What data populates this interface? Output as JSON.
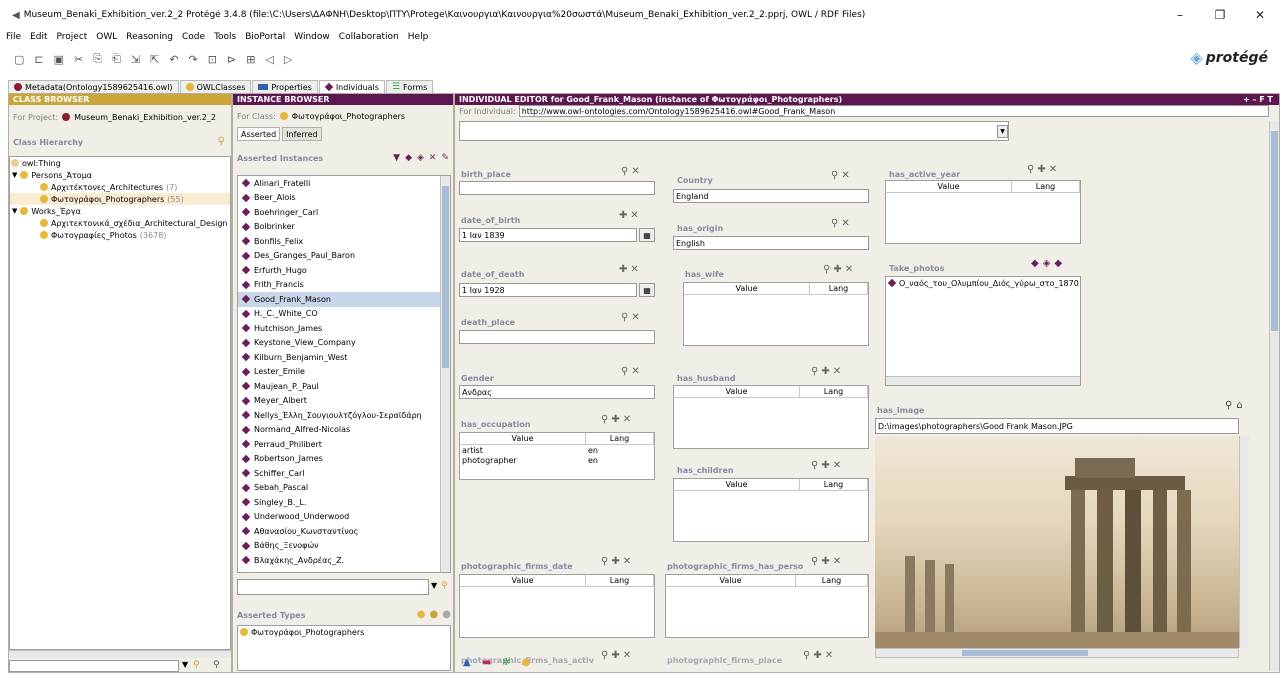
{
  "window": {
    "title": "Museum_Benaki_Exhibition_ver.2_2  Protégé 3.4.8   (file:\\C:\\Users\\ΔΑΦΝΗ\\Desktop\\ΠΤΥ\\Protege\\Καινουργια\\Καινουργια%20σωστά\\Museum_Benaki_Exhibition_ver.2_2.pprj, OWL / RDF Files)",
    "minimize": "–",
    "maximize": "❐",
    "close": "✕"
  },
  "menu": [
    "File",
    "Edit",
    "Project",
    "OWL",
    "Reasoning",
    "Code",
    "Tools",
    "BioPortal",
    "Window",
    "Collaboration",
    "Help"
  ],
  "logo": "protégé",
  "tabs": [
    {
      "label": "Metadata(Ontology1589625416.owl)",
      "color": "#8a1c30"
    },
    {
      "label": "OWLClasses",
      "color": "#e8b838"
    },
    {
      "label": "Properties",
      "color": "#3060b0"
    },
    {
      "label": "Individuals",
      "color": "#6b1f5a"
    },
    {
      "label": "Forms",
      "color": "#30a050"
    }
  ],
  "class_browser": {
    "header": "CLASS BROWSER",
    "project_label": "For Project:",
    "project_name": "Museum_Benaki_Exhibition_ver.2_2",
    "hierarchy_label": "Class Hierarchy",
    "tree": [
      {
        "label": "owl:Thing",
        "count": ""
      },
      {
        "label": "Persons_Άτομα",
        "count": ""
      },
      {
        "label": "Αρχιτέκτονες_Architectures",
        "count": "(7)"
      },
      {
        "label": "Φωτογράφοι_Photographers",
        "count": "(55)"
      },
      {
        "label": "Works_Έργα",
        "count": ""
      },
      {
        "label": "Αρχιτεκτονικά_σχέδια_Architectural_Design",
        "count": ""
      },
      {
        "label": "Φωτογραφίες_Photos",
        "count": "(3678)"
      }
    ]
  },
  "instance_browser": {
    "header": "INSTANCE BROWSER",
    "class_label": "For Class:",
    "class_name": "Φωτογράφοι_Photographers",
    "tab_asserted": "Asserted",
    "tab_inferred": "Inferred",
    "instances_label": "Asserted Instances",
    "instances": [
      "Alinari_Fratelli",
      "Beer_Alois",
      "Boehringer_Carl",
      "Bolbrinker",
      "Bonfils_Felix",
      "Des_Granges_Paul_Baron",
      "Erfurth_Hugo",
      "Frith_Francis",
      "Good_Frank_Mason",
      "H._C._White_CO",
      "Hutchison_James",
      "Keystone_View_Company",
      "Kilburn_Benjamin_West",
      "Lester_Emile",
      "Maujean_P._Paul",
      "Meyer_Albert",
      "Nellys_Έλλη_Σουγιουλτζόγλου-Σεραϊδάρη",
      "Normand_Alfred-Nicolas",
      "Perraud_Philibert",
      "Robertson_James",
      "Schiffer_Carl",
      "Sebah_Pascal",
      "Singley_B._L.",
      "Underwood_Underwood",
      "Αθανασίου_Κωνσταντίνος",
      "Βάθης_Ξενοφών",
      "Βλαχάκης_Ανδρέας_Ζ."
    ],
    "selected": "Good_Frank_Mason",
    "types_label": "Asserted Types",
    "types": [
      "Φωτογράφοι_Photographers"
    ]
  },
  "editor": {
    "header": "INDIVIDUAL EDITOR for Good_Frank_Mason   (instance of Φωτογράφοι_Photographers)",
    "header_buttons": "+ – F T",
    "for_individual_label": "For Individual:",
    "individual_uri": "http://www.owl-ontologies.com/Ontology1589625416.owl#Good_Frank_Mason",
    "birth_place": {
      "label": "birth_place",
      "value": ""
    },
    "date_of_birth": {
      "label": "date_of_birth",
      "value": "1 Ιαν 1839"
    },
    "date_of_death": {
      "label": "date_of_death",
      "value": "1 Ιαν 1928"
    },
    "death_place": {
      "label": "death_place",
      "value": ""
    },
    "gender": {
      "label": "Gender",
      "value": "Ανδρας"
    },
    "has_occupation": {
      "label": "has_occupation",
      "rows": [
        {
          "value": "artist",
          "lang": "en"
        },
        {
          "value": "photographer",
          "lang": "en"
        }
      ]
    },
    "country": {
      "label": "Country",
      "value": "England"
    },
    "has_origin": {
      "label": "has_origin",
      "value": "English"
    },
    "has_wife": {
      "label": "has_wife"
    },
    "has_husband": {
      "label": "has_husband"
    },
    "has_children": {
      "label": "has_children"
    },
    "photographic_firms_date": {
      "label": "photographic_firms_date"
    },
    "photographic_firms_has_person": {
      "label": "photographic_firms_has_perso"
    },
    "photographic_firms_has_active": {
      "label": "photographic_firms_has_activ"
    },
    "photographic_firms_place": {
      "label": "photographic_firms_place"
    },
    "has_active_year": {
      "label": "has_active_year"
    },
    "take_photos": {
      "label": "Take_photos",
      "items": [
        "Ο_ναός_του_Ολυμπίου_Διός_γύρω_στο_1870"
      ]
    },
    "has_image": {
      "label": "has_image",
      "value": "D:\\images\\photographers\\Good Frank Mason.JPG"
    },
    "col_value": "Value",
    "col_lang": "Lang"
  }
}
